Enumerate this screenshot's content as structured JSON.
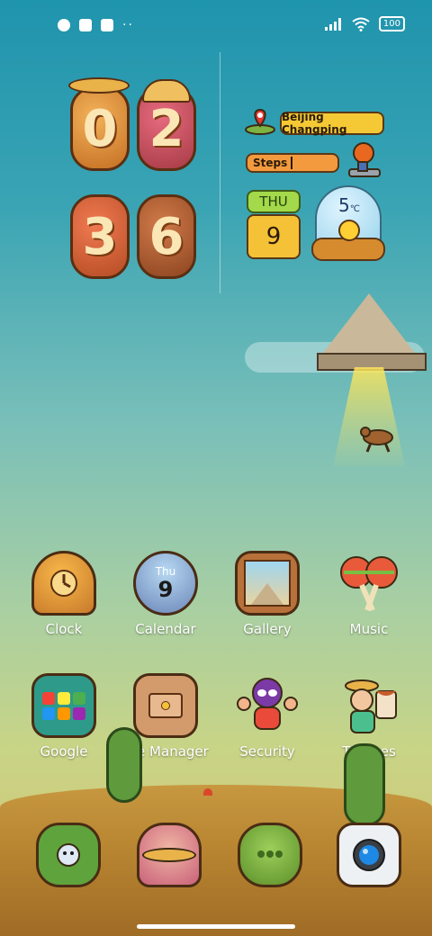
{
  "status_bar": {
    "battery": "100",
    "dots": "··"
  },
  "clock": {
    "digits": [
      "0",
      "2",
      "3",
      "6"
    ]
  },
  "location": {
    "label": "Beijing Changping"
  },
  "steps": {
    "label": "Steps"
  },
  "calendar_widget": {
    "day": "THU",
    "date": "9"
  },
  "weather": {
    "temperature": "5",
    "unit": "℃"
  },
  "apps_row1": [
    {
      "label": "Clock",
      "icon": "bell-clock-icon"
    },
    {
      "label": "Calendar",
      "icon": "ufo-calendar-icon",
      "day": "Thu",
      "date": "9"
    },
    {
      "label": "Gallery",
      "icon": "pyramid-frame-icon"
    },
    {
      "label": "Music",
      "icon": "maracas-icon"
    }
  ],
  "apps_row2": [
    {
      "label": "Google",
      "icon": "google-folder-icon"
    },
    {
      "label": "File Manager",
      "icon": "cabinet-icon"
    },
    {
      "label": "Security",
      "icon": "luchador-icon"
    },
    {
      "label": "Themes",
      "icon": "painter-icon"
    }
  ],
  "dock": [
    {
      "icon": "cactus-phone-icon"
    },
    {
      "icon": "sombrero-messages-icon"
    },
    {
      "icon": "cactus-browser-icon"
    },
    {
      "icon": "camera-icon"
    }
  ],
  "colors": {
    "sky_top": "#1f94ad",
    "sand": "#c79840",
    "accent_yellow": "#f4c935",
    "accent_orange": "#f39a3f",
    "accent_green": "#a3d94a"
  }
}
